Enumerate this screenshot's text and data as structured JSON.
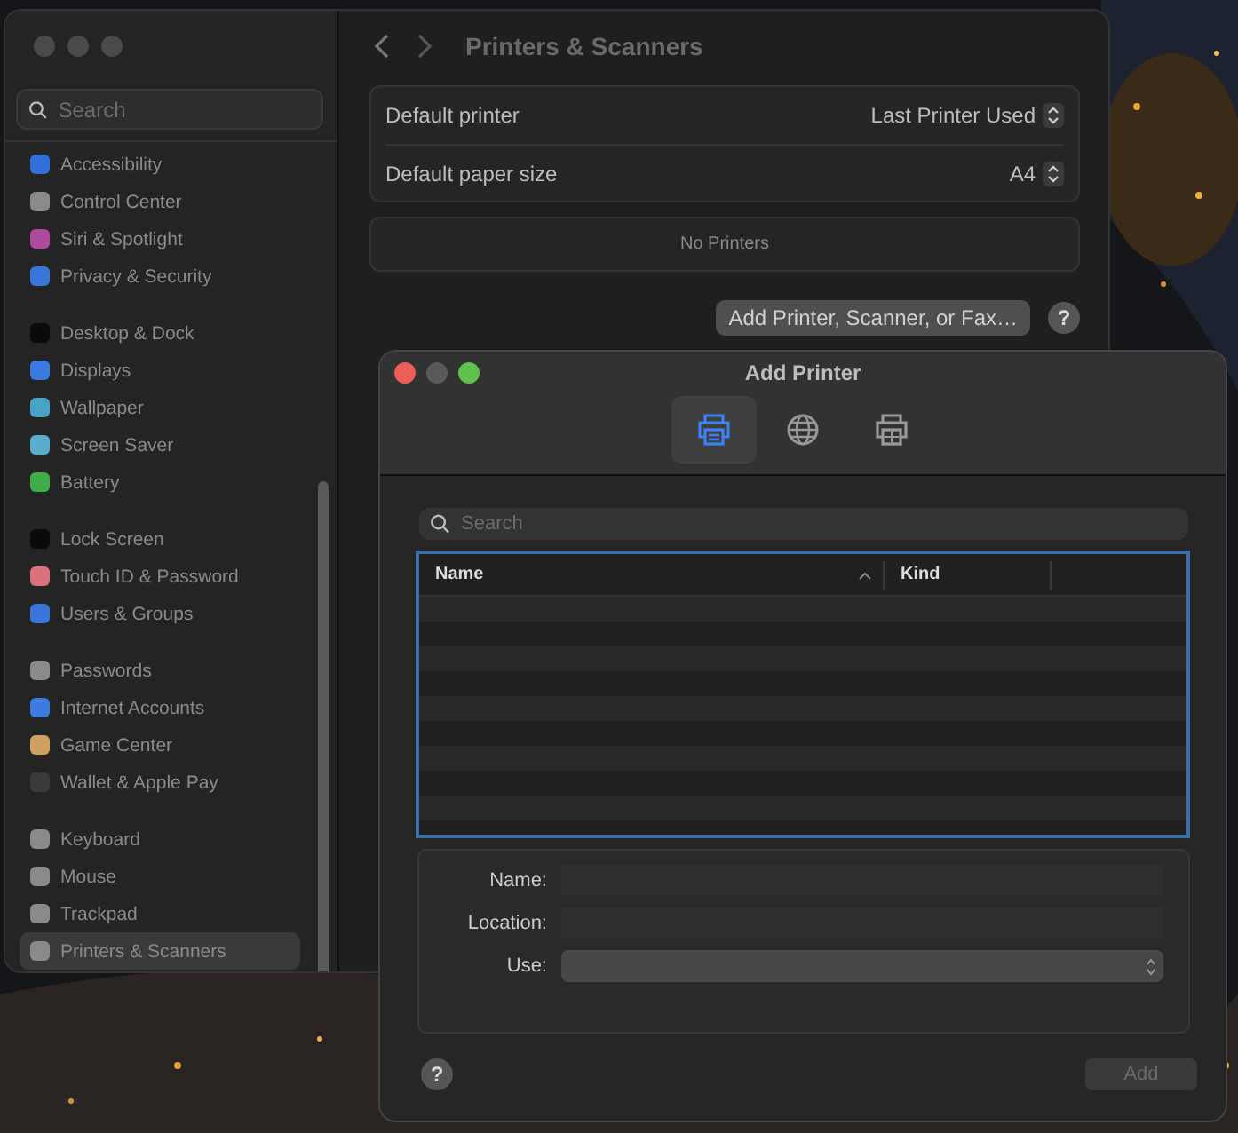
{
  "settings": {
    "search": {
      "placeholder": "Search"
    },
    "sidebar": {
      "groups": [
        [
          {
            "label": "Accessibility",
            "color": "#2f6fd6",
            "selected": false
          },
          {
            "label": "Control Center",
            "color": "#8a8a8a",
            "selected": false
          },
          {
            "label": "Siri & Spotlight",
            "color": "#b04aa0",
            "selected": false
          },
          {
            "label": "Privacy & Security",
            "color": "#3a76d8",
            "selected": false
          }
        ],
        [
          {
            "label": "Desktop & Dock",
            "color": "#0a0a0a",
            "selected": false
          },
          {
            "label": "Displays",
            "color": "#3b7be0",
            "selected": false
          },
          {
            "label": "Wallpaper",
            "color": "#4aa2c4",
            "selected": false
          },
          {
            "label": "Screen Saver",
            "color": "#5aaecc",
            "selected": false
          },
          {
            "label": "Battery",
            "color": "#3fae4a",
            "selected": false
          }
        ],
        [
          {
            "label": "Lock Screen",
            "color": "#0a0a0a",
            "selected": false
          },
          {
            "label": "Touch ID & Password",
            "color": "#d9727a",
            "selected": false
          },
          {
            "label": "Users & Groups",
            "color": "#3a76d8",
            "selected": false
          }
        ],
        [
          {
            "label": "Passwords",
            "color": "#8a8a8a",
            "selected": false
          },
          {
            "label": "Internet Accounts",
            "color": "#3b7be0",
            "selected": false
          },
          {
            "label": "Game Center",
            "color": "#d0a060",
            "selected": false
          },
          {
            "label": "Wallet & Apple Pay",
            "color": "#3a3a3a",
            "selected": false
          }
        ],
        [
          {
            "label": "Keyboard",
            "color": "#8a8a8a",
            "selected": false
          },
          {
            "label": "Mouse",
            "color": "#8a8a8a",
            "selected": false
          },
          {
            "label": "Trackpad",
            "color": "#8a8a8a",
            "selected": false
          },
          {
            "label": "Printers & Scanners",
            "color": "#8a8a8a",
            "selected": true
          }
        ]
      ]
    },
    "title": "Printers & Scanners",
    "defaults": [
      {
        "label": "Default printer",
        "value": "Last Printer Used"
      },
      {
        "label": "Default paper size",
        "value": "A4"
      }
    ],
    "printers_empty": "No Printers",
    "add_button": "Add Printer, Scanner, or Fax…",
    "help": "?"
  },
  "dialog": {
    "title": "Add Printer",
    "tabs": [
      {
        "kind": "printer",
        "selected": true
      },
      {
        "kind": "globe",
        "selected": false
      },
      {
        "kind": "windows",
        "selected": false
      }
    ],
    "search": {
      "placeholder": "Search"
    },
    "table": {
      "columns": [
        {
          "label": "Name",
          "sorted": true
        },
        {
          "label": "Kind",
          "sorted": false
        }
      ]
    },
    "form": [
      {
        "label": "Name:",
        "kind": "text"
      },
      {
        "label": "Location:",
        "kind": "text"
      },
      {
        "label": "Use:",
        "kind": "select"
      }
    ],
    "help": "?",
    "add_button": {
      "label": "Add",
      "disabled": true
    }
  }
}
